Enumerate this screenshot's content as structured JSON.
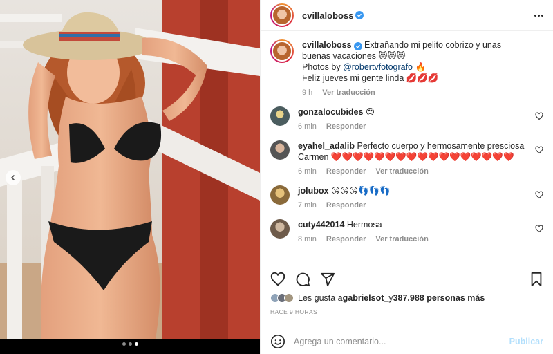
{
  "post": {
    "author": "cvillaloboss",
    "caption": "Extrañando mi pelito cobrizo y unas buenas vacaciones 😻😻😻",
    "photos_prefix": "Photos by ",
    "photos_mention": "@robertvfotografo",
    "photos_emoji": " 🔥",
    "caption_line3": "Feliz jueves mi gente linda 💋💋💋",
    "caption_time": "9 h",
    "see_translation": "Ver traducción"
  },
  "comments": [
    {
      "user": "gonzalocubides",
      "text": "😍",
      "time": "6 min",
      "reply": "Responder",
      "translate": ""
    },
    {
      "user": "eyahel_adalib",
      "text": "Perfecto cuerpo y hermosamente presciosa Carmen ❤️❤️❤️❤️❤️❤️❤️❤️❤️❤️❤️❤️❤️❤️❤️❤️❤️",
      "time": "6 min",
      "reply": "Responder",
      "translate": "Ver traducción"
    },
    {
      "user": "jolubox",
      "text": "😘😘😘👣👣👣",
      "time": "7 min",
      "reply": "Responder",
      "translate": ""
    },
    {
      "user": "cuty442014",
      "text": "Hermosa",
      "time": "8 min",
      "reply": "Responder",
      "translate": "Ver traducción"
    }
  ],
  "likes": {
    "prefix": "Les gusta a ",
    "user": "gabrielsot_",
    "conj": " y ",
    "count": "387.988 personas más"
  },
  "timestamp": "Hace 9 horas",
  "add_comment": {
    "placeholder": "Agrega un comentario...",
    "publish": "Publicar"
  },
  "carousel": {
    "count": 3,
    "active_index": 2
  },
  "colors": {
    "verified": "#3897f0",
    "mention": "#00376b",
    "publish_disabled": "#b2dffc",
    "muted": "#8e8e8e"
  }
}
